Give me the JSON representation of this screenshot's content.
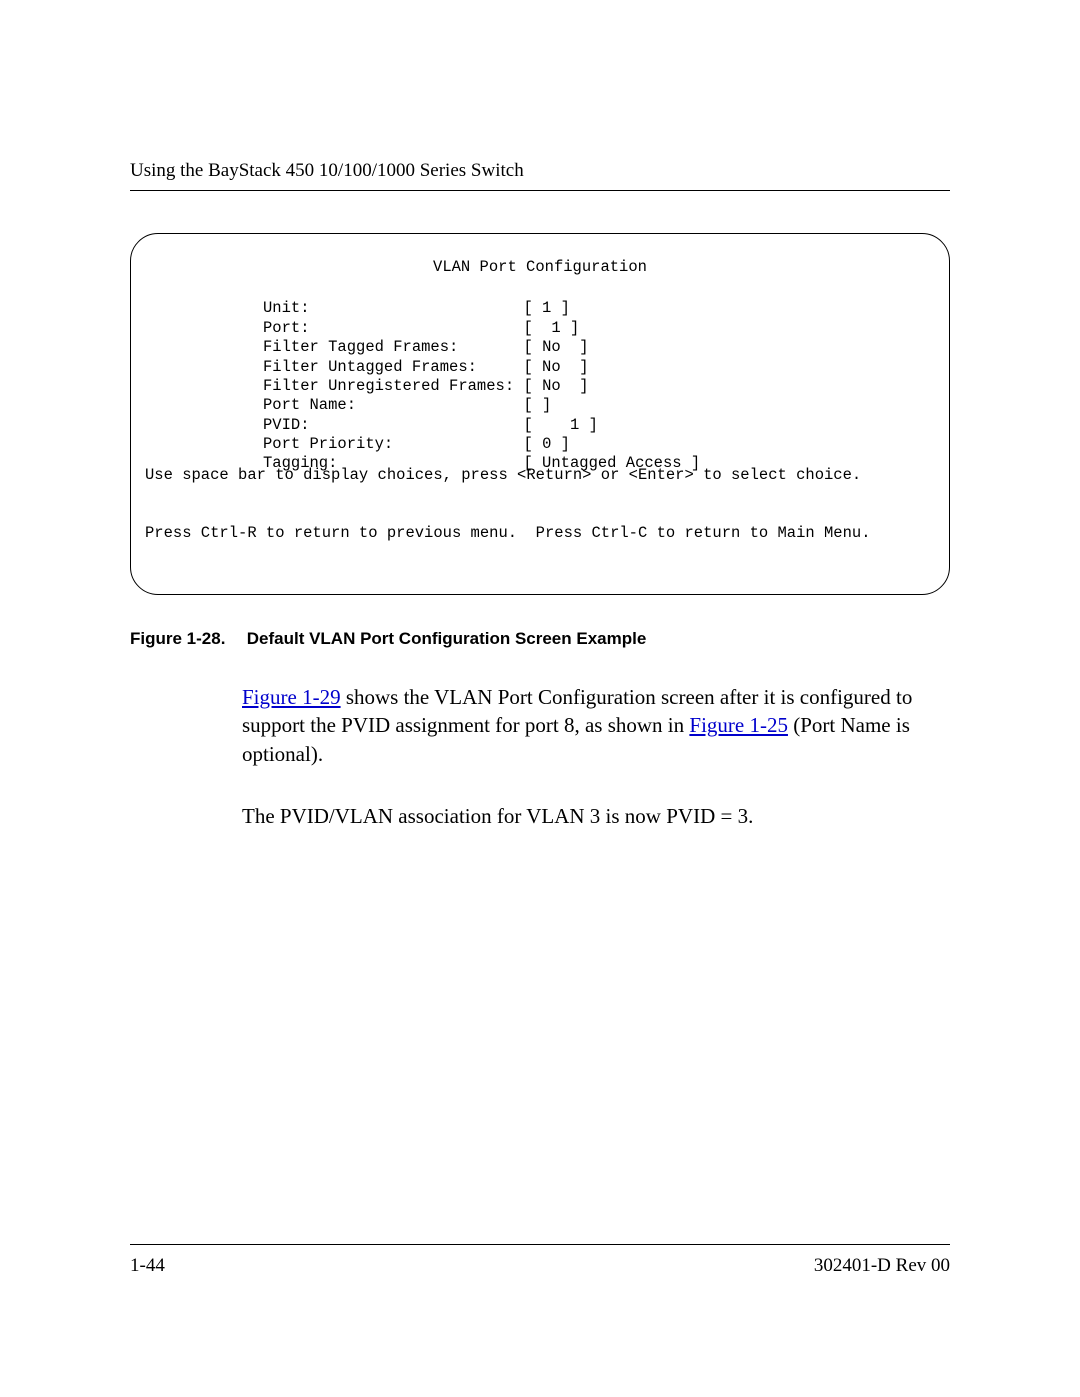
{
  "header": {
    "running_title": "Using the BayStack 450 10/100/1000 Series Switch"
  },
  "terminal": {
    "title": "VLAN Port Configuration",
    "fields": [
      {
        "label": "Unit:",
        "value": "[ 1 ]"
      },
      {
        "label": "Port:",
        "value": "[  1 ]"
      },
      {
        "label": "Filter Tagged Frames:",
        "value": "[ No  ]"
      },
      {
        "label": "Filter Untagged Frames:",
        "value": "[ No  ]"
      },
      {
        "label": "Filter Unregistered Frames:",
        "value": "[ No  ]"
      },
      {
        "label": "Port Name:",
        "value": "[ ]"
      },
      {
        "label": "PVID:",
        "value": "[    1 ]"
      },
      {
        "label": "Port Priority:",
        "value": "[ 0 ]"
      },
      {
        "label": "Tagging:",
        "value": "[ Untagged Access ]"
      }
    ],
    "footer_line1": "Use space bar to display choices, press <Return> or <Enter> to select choice.",
    "footer_line2": "Press Ctrl-R to return to previous menu.  Press Ctrl-C to return to Main Menu."
  },
  "caption": {
    "label": "Figure 1-28.",
    "text": "Default VLAN Port Configuration Screen Example"
  },
  "body": {
    "link1": "Figure 1-29",
    "seg1": " shows the VLAN Port Configuration screen after it is configured to support the PVID assignment for port 8, as shown in ",
    "link2": "Figure 1-25",
    "seg2": " (Port Name is optional).",
    "para2": "The PVID/VLAN association for VLAN 3 is now PVID = 3."
  },
  "footer": {
    "page": "1-44",
    "docid": "302401-D Rev 00"
  }
}
